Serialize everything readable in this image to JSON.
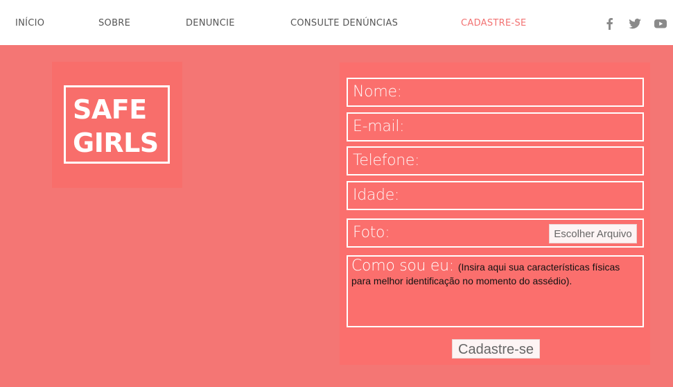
{
  "nav": {
    "items": [
      {
        "label": "INÍCIO"
      },
      {
        "label": "SOBRE"
      },
      {
        "label": "DENUNCIE"
      },
      {
        "label": "CONSULTE DENÚNCIAS"
      },
      {
        "label": "CADASTRE-SE",
        "active": true
      }
    ],
    "social": [
      "facebook-icon",
      "twitter-icon",
      "youtube-icon"
    ]
  },
  "logo": {
    "line1": "SAFE",
    "line2": "GIRLS"
  },
  "form": {
    "fields": [
      {
        "label": "Nome:"
      },
      {
        "label": "E-mail:"
      },
      {
        "label": "Telefone:"
      },
      {
        "label": "Idade:"
      }
    ],
    "photo": {
      "label": "Foto:",
      "button": "Escolher Arquivo"
    },
    "about": {
      "label": "Como sou eu:",
      "hint": "(Insira aqui sua características físicas para melhor identificação no momento do assédio)."
    },
    "submit": "Cadastre-se"
  },
  "colors": {
    "background": "#F47674",
    "panel": "#FB6F6D",
    "nav_active": "#F27272",
    "nav_text": "#555555"
  }
}
